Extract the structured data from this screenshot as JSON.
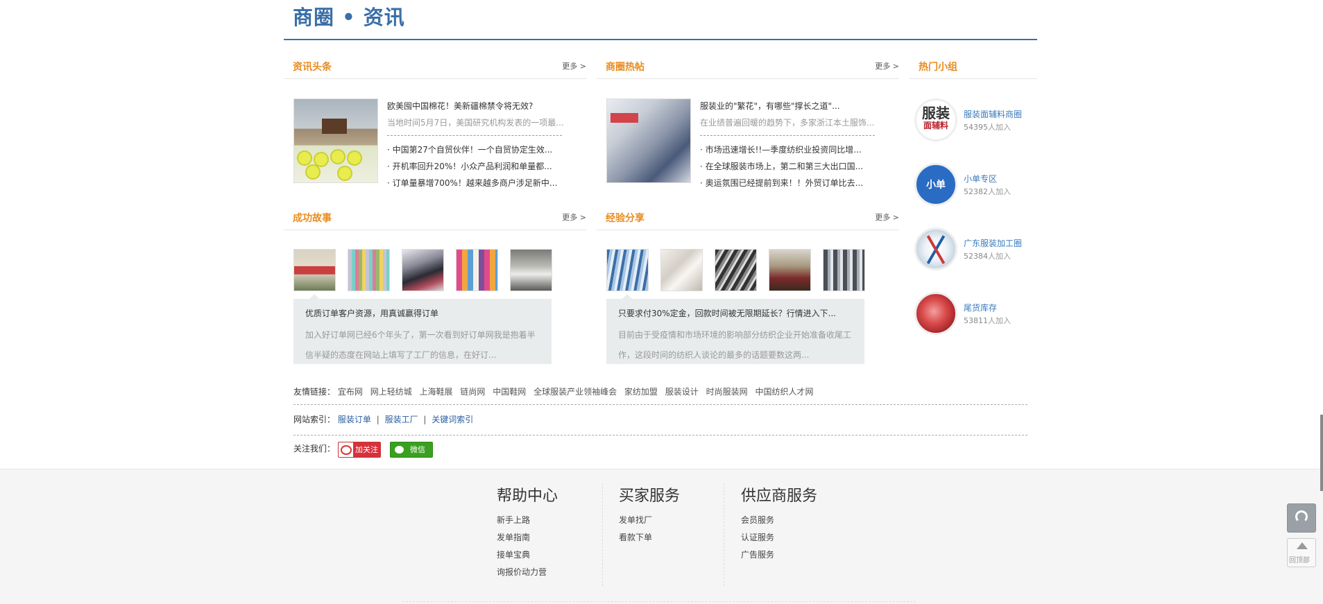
{
  "page": {
    "title": "商圈 • 资讯"
  },
  "news": {
    "heading": "资讯头条",
    "more": "更多 >",
    "image_icon": "cotton-bales-photo",
    "headline": "欧美囤中国棉花！美新疆棉禁令将无效?",
    "summary": "当地时间5月7日，美国研究机构发表的一项最...",
    "items": [
      "· 中国第27个自贸伙伴！一个自贸协定生效...",
      "· 开机率回升20%！小众产品利润和单量都...",
      "· 订单量暴增700%！越来越多商户涉足新中..."
    ]
  },
  "hot": {
    "heading": "商圈热帖",
    "more": "更多 >",
    "image_icon": "garment-factory-photo",
    "headline": "服装业的\"繁花\"，有哪些\"撑长之道\"...",
    "summary": "在业绩普遍回暖的趋势下，多家浙江本土服饰...",
    "items": [
      "· 市场迅速增长!!—季度纺织业投资同比增...",
      "· 在全球服装市场上，第二和第三大出口国...",
      "· 奥运氛围已经提前到来！！外贸订单比去..."
    ]
  },
  "success": {
    "heading": "成功故事",
    "more": "更多 >",
    "thumbs": [
      "office-photo",
      "fabric-rolls-photo",
      "shopper-photo",
      "clothing-rack-photo",
      "workshop-photo"
    ],
    "title": "优质订单客户资源，用真诚赢得订单",
    "desc": "加入好订单网已经6个年头了，第一次看到好订单网我是抱着半信半疑的态度在网站上填写了工厂的信息，在好订..."
  },
  "experience": {
    "heading": "经验分享",
    "more": "更多 >",
    "thumbs": [
      "spinning-mill-photo",
      "white-fabric-photo",
      "weaving-photo",
      "yarn-photo",
      "factory-floor-photo"
    ],
    "title": "只要求付30%定金，回款时间被无限期延长？行情进入下...",
    "desc": "目前由于受疫情和市场环境的影响部分纺织企业开始准备收尾工作，这段时间的纺织人谈论的最多的话题要数这两..."
  },
  "groups": {
    "heading": "热门小组",
    "items": [
      {
        "name": "服装面辅料商圈",
        "count": "54395",
        "suffix": "人加入",
        "avatar_line1": "服装",
        "avatar_line2": "面辅料"
      },
      {
        "name": "小单专区",
        "count": "52382",
        "suffix": "人加入",
        "avatar_line1": "小单"
      },
      {
        "name": "广东服装加工圈",
        "count": "52384",
        "suffix": "人加入"
      },
      {
        "name": "尾货库存",
        "count": "53811",
        "suffix": "人加入"
      }
    ]
  },
  "friend_links": {
    "label": "友情链接：",
    "items": [
      "宜布网",
      "网上轻纺城",
      "上海鞋展",
      "链尚网",
      "中国鞋网",
      "全球服装产业领袖峰会",
      "家纺加盟",
      "服装设计",
      "时尚服装网",
      "中国纺织人才网"
    ]
  },
  "site_index": {
    "label": "网站索引：",
    "items": [
      "服装订单",
      "服装工厂",
      "关键词索引"
    ],
    "sep": "|"
  },
  "follow": {
    "label": "关注我们：",
    "weibo": "加关注",
    "wechat": "微信"
  },
  "footer": {
    "cols": [
      {
        "title": "帮助中心",
        "links": [
          "新手上路",
          "发单指南",
          "接单宝典",
          "询报价动力营"
        ]
      },
      {
        "title": "买家服务",
        "links": [
          "发单找厂",
          "看款下单"
        ]
      },
      {
        "title": "供应商服务",
        "links": [
          "会员服务",
          "认证服务",
          "广告服务"
        ]
      }
    ]
  },
  "side": {
    "back_top": "回顶部"
  }
}
